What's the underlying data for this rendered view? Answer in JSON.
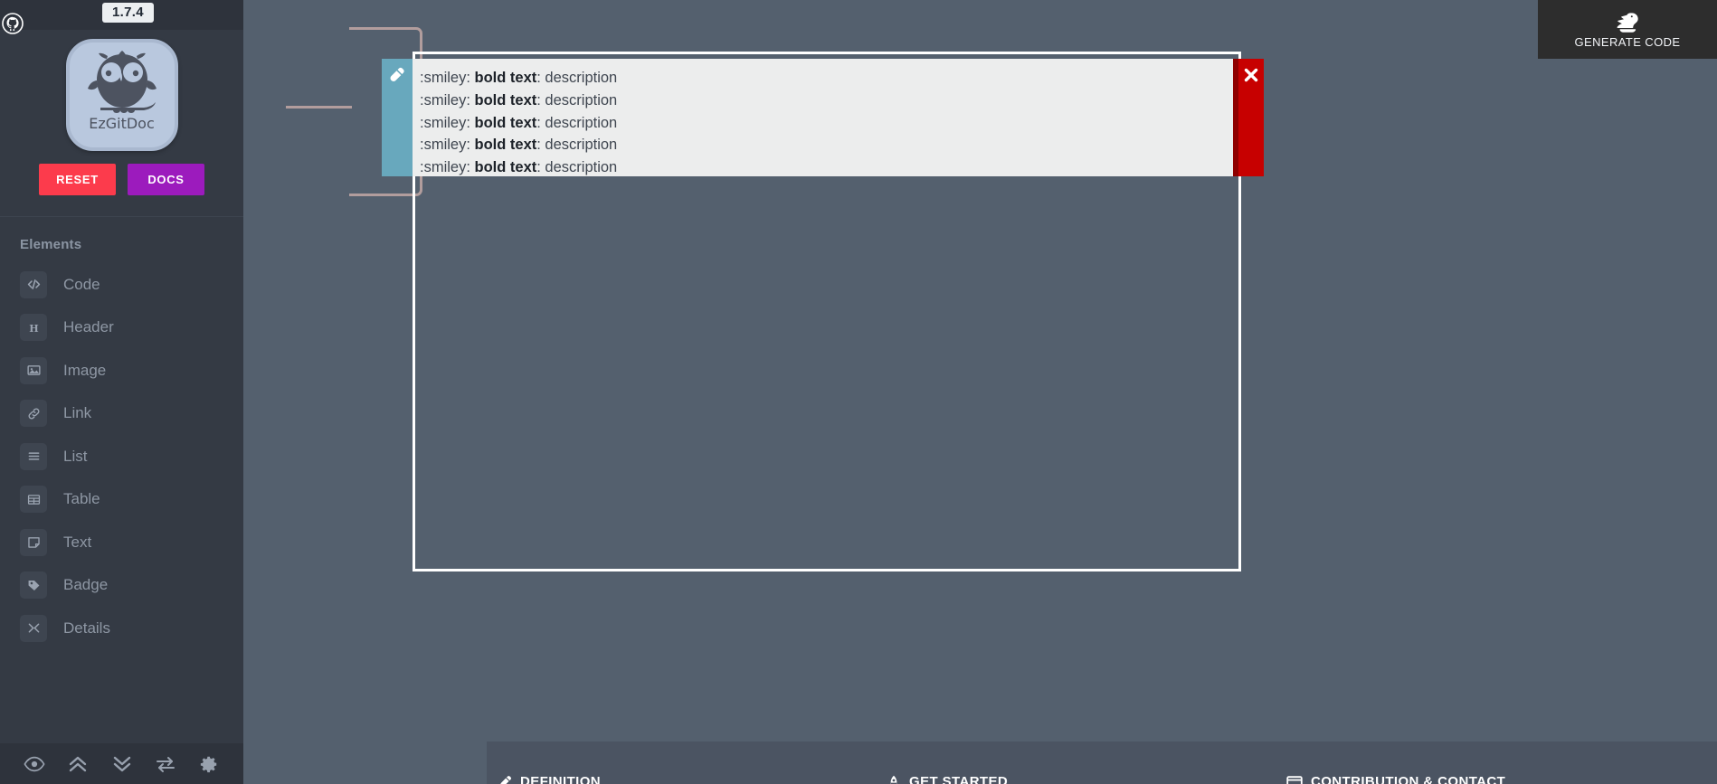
{
  "app": {
    "name": "EzGitDoc",
    "version": "1.7.4"
  },
  "sidebar": {
    "github_icon": "github-icon",
    "logo_word": "EzGitDoc",
    "buttons": {
      "reset": "RESET",
      "docs": "DOCS"
    },
    "elements_title": "Elements",
    "items": [
      {
        "label": "Code",
        "icon": "code-icon"
      },
      {
        "label": "Header",
        "icon": "header-icon"
      },
      {
        "label": "Image",
        "icon": "image-icon"
      },
      {
        "label": "Link",
        "icon": "link-icon"
      },
      {
        "label": "List",
        "icon": "list-icon"
      },
      {
        "label": "Table",
        "icon": "table-icon"
      },
      {
        "label": "Text",
        "icon": "text-icon"
      },
      {
        "label": "Badge",
        "icon": "badge-icon"
      },
      {
        "label": "Details",
        "icon": "details-icon"
      }
    ],
    "footer_tools": [
      {
        "name": "preview-toggle",
        "icon": "eye-icon"
      },
      {
        "name": "collapse-all",
        "icon": "double-chevron-up-icon"
      },
      {
        "name": "expand-all",
        "icon": "double-chevron-down-icon"
      },
      {
        "name": "swap-order",
        "icon": "swap-arrows-icon"
      },
      {
        "name": "settings",
        "icon": "gear-icon"
      }
    ]
  },
  "toolbar": {
    "generate_code_label": "GENERATE CODE",
    "generate_code_icon": "dragon-icon"
  },
  "editor": {
    "edit_icon": "pencil-icon",
    "delete_icon": "close-x-icon",
    "lines": [
      {
        "prefix": ":smiley: ",
        "bold": "bold text",
        "suffix": ": description"
      },
      {
        "prefix": ":smiley: ",
        "bold": "bold text",
        "suffix": ": description"
      },
      {
        "prefix": ":smiley: ",
        "bold": "bold text",
        "suffix": ": description"
      },
      {
        "prefix": ":smiley: ",
        "bold": "bold text",
        "suffix": ": description"
      },
      {
        "prefix": ":smiley: ",
        "bold": "bold text",
        "suffix": ": description"
      }
    ]
  },
  "bottom_bar": {
    "items": [
      {
        "label": "DEFINITION",
        "icon": "pencil-icon"
      },
      {
        "label": "GET STARTED",
        "icon": "rocket-icon"
      },
      {
        "label": "CONTRIBUTION & CONTACT",
        "icon": "window-icon"
      }
    ]
  },
  "colors": {
    "sidebar_bg": "#343a44",
    "sidebar_topbar_bg": "#2e333c",
    "canvas_bg": "#54606e",
    "reset_red": "#fc3b4c",
    "docs_purple": "#9c1bbd",
    "edit_teal": "#68a8bd",
    "delete_red": "#c70000",
    "bracket_mauve": "#b29d9d",
    "row_bg": "#eceded",
    "bottom_bar_bg": "#4b5462",
    "generate_bg": "#2d2d2d"
  }
}
